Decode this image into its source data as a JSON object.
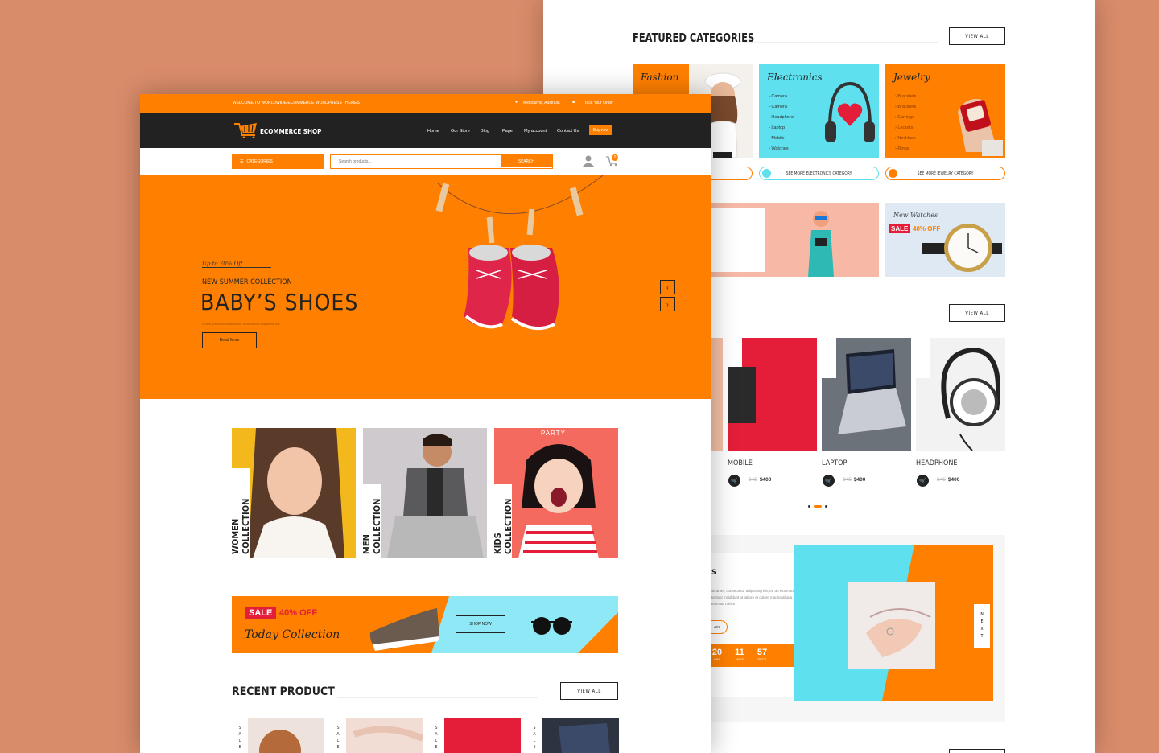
{
  "back": {
    "featured_title": "FEATURED CATEGORIES",
    "view_all": "VIEW ALL",
    "categories": [
      {
        "title": "Fashion",
        "items": []
      },
      {
        "title": "Electronics",
        "items": [
          "Camera",
          "Camera",
          "Headphone",
          "Laptop",
          "Mobile",
          "Watches"
        ]
      },
      {
        "title": "Jewelry",
        "items": [
          "Bracelets",
          "Bracelets",
          "Earrings",
          "Lockets",
          "Necklace",
          "Rings"
        ]
      }
    ],
    "category_buttons": [
      "SEE MORE ELECTRONICS CATEGORY",
      "SEE MORE JEWELRY CATEGORY"
    ],
    "watch_banner": {
      "script": "New Watches",
      "sale": "SALE",
      "off": "40% OFF"
    },
    "products": [
      {
        "name": "MOBILE",
        "old": "$45",
        "price": "$400"
      },
      {
        "name": "LAPTOP",
        "old": "$45",
        "price": "$400"
      },
      {
        "name": "HEADPHONE",
        "old": "$45",
        "price": "$400"
      }
    ],
    "sale_letters": [
      "S",
      "A",
      "L",
      "E"
    ],
    "deal": {
      "heading_frag": "S",
      "text": "sit amet, consectetur adipiscing elit, ed do eiusmod tempor incididunt ut labore et dolore magna aliqua. Ut enim ad minim",
      "button_frag": "ART",
      "countdown": [
        {
          "value": "20",
          "label": "HRS"
        },
        {
          "value": "11",
          "label": "MINS"
        },
        {
          "value": "57",
          "label": "SECS"
        }
      ],
      "next_letters": [
        "N",
        "E",
        "X",
        "T"
      ]
    }
  },
  "front": {
    "topbar": {
      "welcome": "WELCOME TO WORLDWIDE ECOMMERCE WORDPRESS THEMES",
      "location": "Melbourne, Australia",
      "track": "Track Your Order"
    },
    "logo": "ECOMMERCE SHOP",
    "nav": [
      "Home",
      "Our Store",
      "Blog",
      "Page",
      "My account",
      "Contact Us"
    ],
    "buy_now": "Buy now",
    "categories_btn": "CATEGORIES",
    "search": {
      "placeholder": "Search products...",
      "button": "SEARCH"
    },
    "cart_count": "0",
    "hero": {
      "offer": "Up to 70% Off",
      "subtitle": "NEW SUMMER COLLECTION",
      "title": "BABY’S SHOES",
      "desc": "Lorem ipsum dolor sit amet, consectetur adipiscing elit.",
      "button": "Read More"
    },
    "collections": [
      "WOMEN COLLECTION",
      "MEN COLLECTION",
      "KIDS COLLECTION"
    ],
    "party_text": "PARTY",
    "promo": {
      "sale": "SALE",
      "off": "40% OFF",
      "script": "Today Collection",
      "button": "SHOP NOW"
    },
    "recent": {
      "title": "RECENT PRODUCT",
      "view_all": "VIEW ALL"
    },
    "sale_letters": [
      "S",
      "A",
      "L",
      "E"
    ]
  }
}
